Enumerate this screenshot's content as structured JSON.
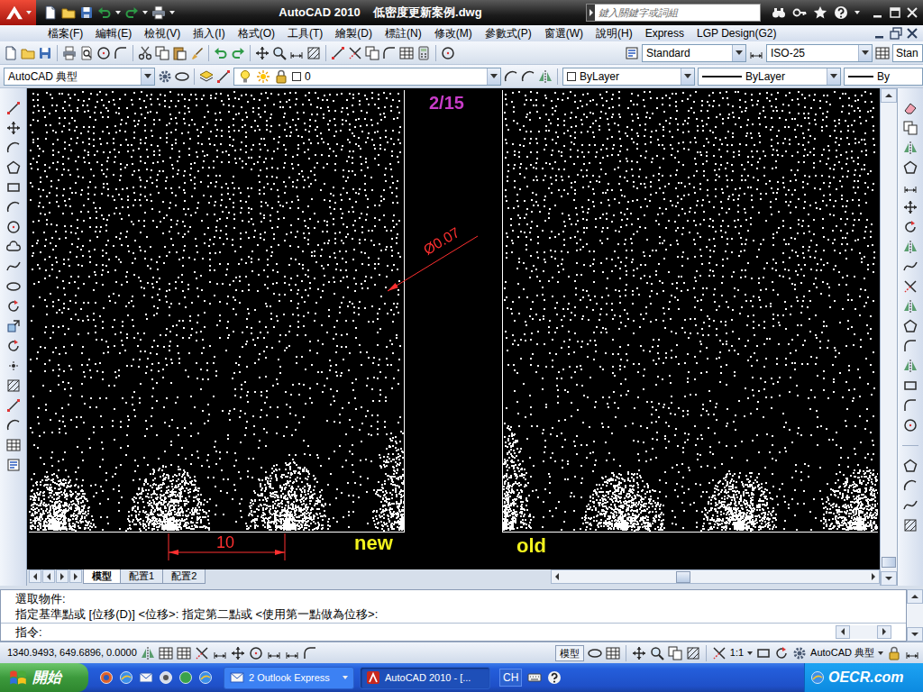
{
  "window": {
    "title": "AutoCAD 2010    低密度更新案例.dwg",
    "search_placeholder": "鍵入關鍵字或詞組"
  },
  "menu": [
    "檔案(F)",
    "編輯(E)",
    "檢視(V)",
    "插入(I)",
    "格式(O)",
    "工具(T)",
    "繪製(D)",
    "標註(N)",
    "修改(M)",
    "參數式(P)",
    "窗選(W)",
    "說明(H)",
    "Express",
    "LGP Design(G2)"
  ],
  "toolbar": {
    "text_style": "Standard",
    "dim_style": "ISO-25",
    "table_style": "Stan",
    "workspace": "AutoCAD 典型",
    "layer": "0",
    "color": "ByLayer",
    "linetype": "ByLayer",
    "lineweight": "By"
  },
  "drawing": {
    "page": "2/15",
    "diameter": "Ø0.07",
    "spacing": "10",
    "panels": [
      {
        "label": "new"
      },
      {
        "label": "old"
      }
    ]
  },
  "layout_tabs": [
    {
      "label": "模型",
      "selected": true
    },
    {
      "label": "配置1",
      "selected": false
    },
    {
      "label": "配置2",
      "selected": false
    }
  ],
  "command": {
    "history": [
      "選取物件:",
      "指定基準點或 [位移(D)] <位移>: 指定第二點或 <使用第一點做為位移>:"
    ],
    "prompt": "指令:"
  },
  "status_bar": {
    "coords": "1340.9493, 649.6896, 0.0000",
    "space": "模型",
    "scale": "1:1",
    "workspace": "AutoCAD 典型"
  },
  "taskbar": {
    "start": "開始",
    "tasks": [
      {
        "label": "2 Outlook Express",
        "selected": false
      },
      {
        "label": "AutoCAD 2010 - [...",
        "selected": true
      }
    ],
    "language": "CH",
    "watermark": "OECR.com"
  }
}
